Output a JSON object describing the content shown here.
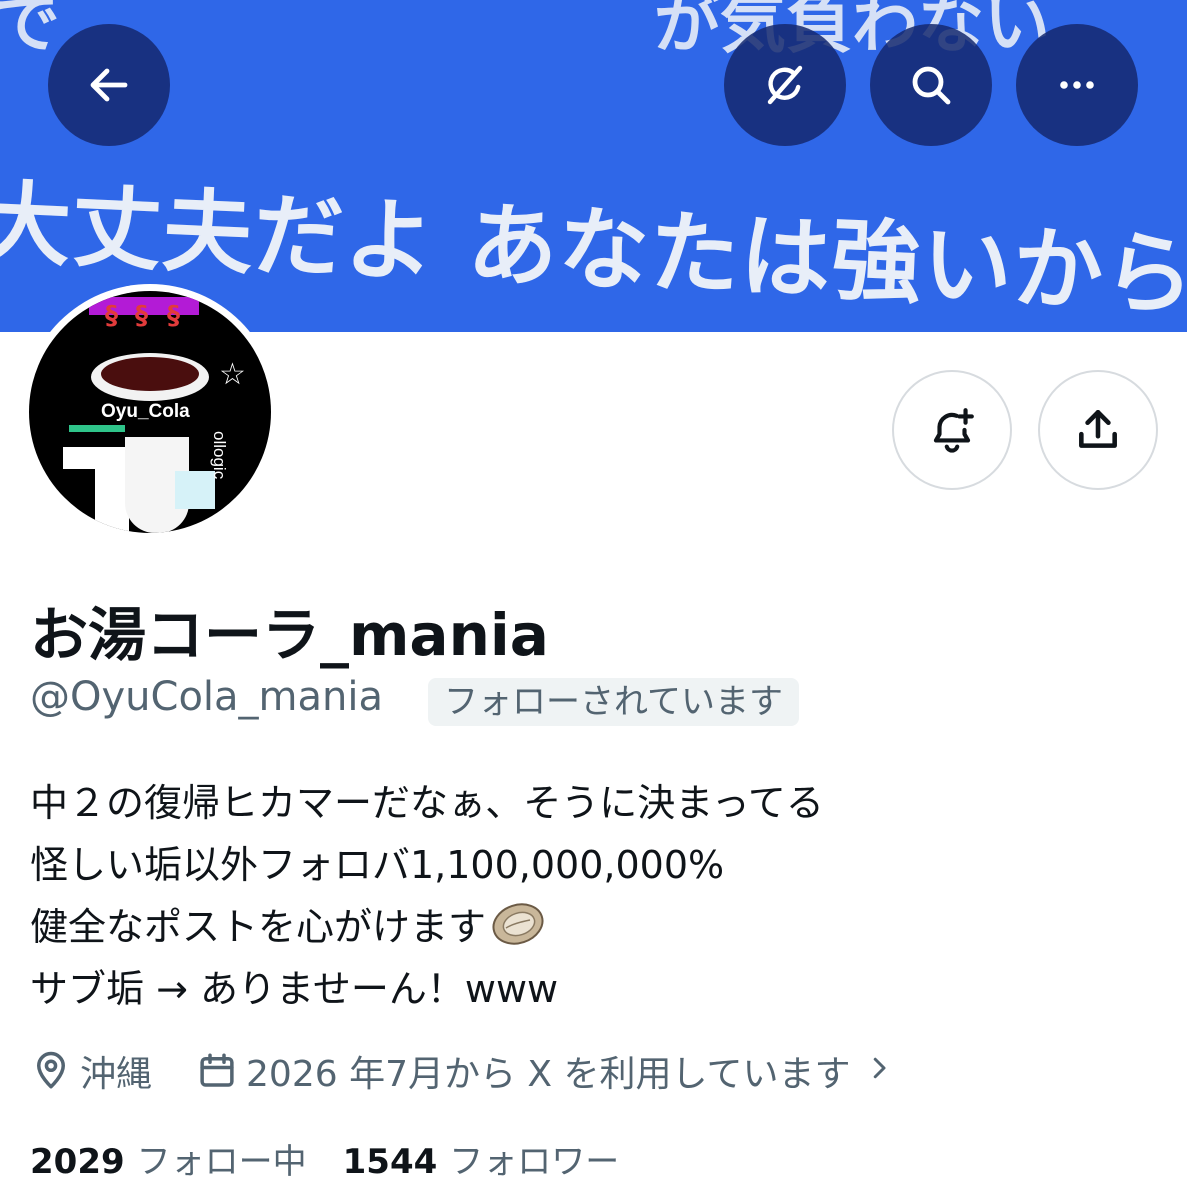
{
  "banner": {
    "top_text": "で　　　　　　　　　が気負わない",
    "main_text": "大丈夫だよ あなたは強いから"
  },
  "nav": {
    "back_icon": "arrow-left-icon",
    "grok_icon": "grok-icon",
    "search_icon": "search-icon",
    "more_icon": "more-horizontal-icon"
  },
  "avatar": {
    "label": "Oyu_Cola",
    "side_text": "ollogic"
  },
  "actions": {
    "notify_icon": "bell-plus-icon",
    "share_icon": "share-upload-icon"
  },
  "profile": {
    "display_name": "お湯コーラ_mania",
    "handle": "@OyuCola_mania",
    "follows_you": "フォローされています",
    "bio": [
      "中２の復帰ヒカマーだなぁ、そうに決まってる",
      "怪しい垢以外フォロバ1,100,000,000%",
      "健全なポストを心がけます",
      "サブ垢 → ありませーん！www"
    ],
    "location": "沖縄",
    "joined": "2026 年7月から X を利用しています"
  },
  "stats": {
    "following_count": "2029",
    "following_label": "フォロー中",
    "followers_count": "1544",
    "followers_label": "フォロワー"
  },
  "colors": {
    "banner": "#2f67e8",
    "text_primary": "#0f1419",
    "text_secondary": "#536471",
    "badge_bg": "#eff3f4"
  }
}
